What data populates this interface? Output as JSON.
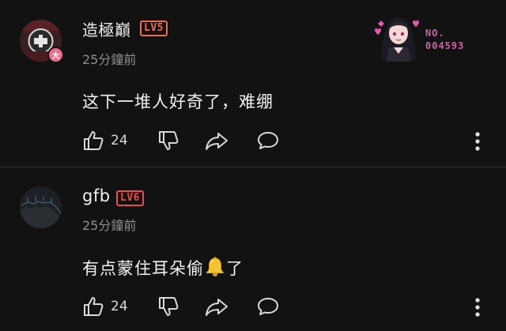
{
  "comments": [
    {
      "username": "造極巔",
      "level": "LV5",
      "time": "25分鐘前",
      "text": "这下一堆人好奇了，难绷",
      "likes": "24",
      "avatar_badge": "大",
      "badge": {
        "no_label": "NO.",
        "no_value": "004593"
      },
      "icons": [
        "thumbs-up-icon",
        "thumbs-down-icon",
        "share-icon",
        "reply-icon",
        "more-vertical-icon"
      ]
    },
    {
      "username": "gfb",
      "level": "LV6",
      "time": "25分鐘前",
      "text_before": "有点蒙住耳朵偷",
      "text_after": "了",
      "inline_emoji": "bell-emoji",
      "likes": "24",
      "icons": [
        "thumbs-up-icon",
        "thumbs-down-icon",
        "share-icon",
        "reply-icon",
        "more-vertical-icon"
      ]
    }
  ],
  "colors": {
    "background": "#121212",
    "level5": "#f26a4f",
    "level6": "#ef4d4d",
    "badge_pink": "#d35fa9"
  }
}
